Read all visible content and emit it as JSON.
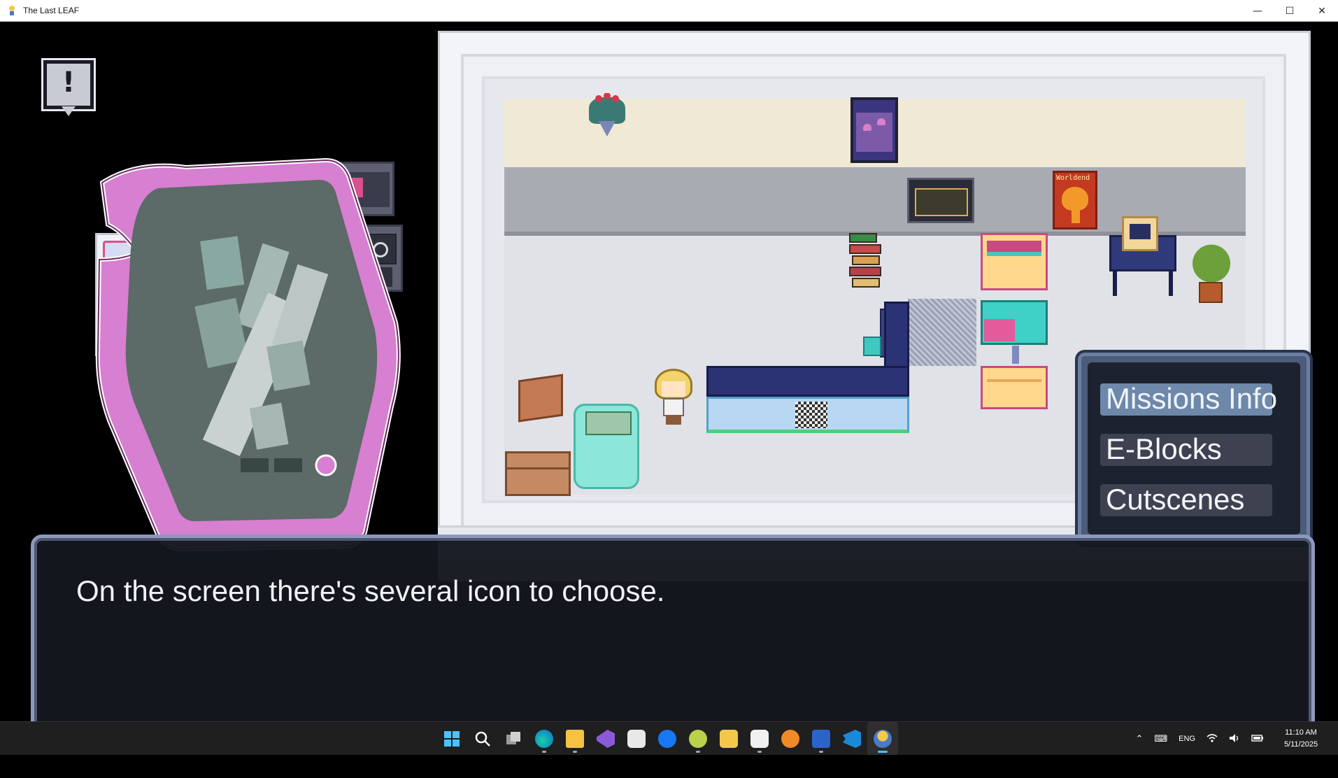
{
  "window": {
    "title": "The Last LEAF",
    "minimize": "—",
    "maximize": "☐",
    "close": "✕"
  },
  "game": {
    "alert_mark": "!",
    "poster_text": "Worldend",
    "menu": {
      "items": [
        {
          "label": "Missions Info",
          "selected": true
        },
        {
          "label": "E-Blocks",
          "selected": false
        },
        {
          "label": "Cutscenes",
          "selected": false
        }
      ]
    },
    "dialog": {
      "text": "On the screen there's several icon to choose."
    }
  },
  "taskbar": {
    "apps": [
      "start-icon",
      "search-icon",
      "task-view-icon",
      "edge-icon",
      "file-explorer-icon",
      "visual-studio-icon",
      "app-icon",
      "facebook-icon",
      "tennis-ball-icon",
      "sticky-app-icon",
      "bot-app-icon",
      "blender-icon",
      "word-icon",
      "vscode-icon",
      "game-icon"
    ],
    "tray": {
      "lang": "ENG",
      "time": "11:10 AM",
      "date": "5/11/2025"
    }
  },
  "colors": {
    "menu_selected": "#6d88a8",
    "dialog_border": "#8d99ba",
    "watch_pink": "#d77fd0"
  }
}
